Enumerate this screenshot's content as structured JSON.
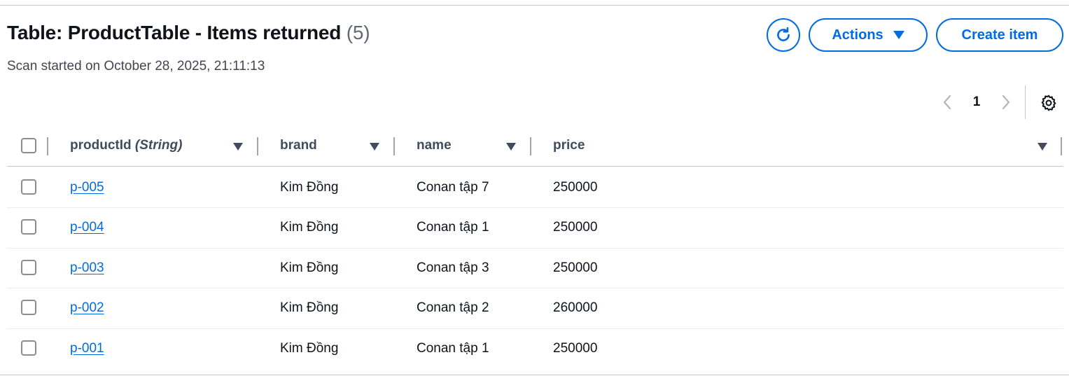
{
  "header": {
    "title": "Table: ProductTable - Items returned",
    "count": "(5)",
    "subtitle": "Scan started on October 28, 2025, 21:11:13",
    "refresh_icon": "refresh-icon",
    "actions_label": "Actions",
    "create_label": "Create item"
  },
  "pagination": {
    "current_page": "1",
    "prev_icon": "chevron-left-icon",
    "next_icon": "chevron-right-icon",
    "settings_icon": "gear-icon"
  },
  "table": {
    "columns": [
      {
        "label": "productId",
        "type": "(String)"
      },
      {
        "label": "brand"
      },
      {
        "label": "name"
      },
      {
        "label": "price"
      }
    ],
    "rows": [
      {
        "productId": "p-005",
        "brand": "Kim Đồng",
        "name": "Conan tập 7",
        "price": "250000"
      },
      {
        "productId": "p-004",
        "brand": "Kim Đồng",
        "name": "Conan tập 1",
        "price": "250000"
      },
      {
        "productId": "p-003",
        "brand": "Kim Đồng",
        "name": "Conan tập 3",
        "price": "250000"
      },
      {
        "productId": "p-002",
        "brand": "Kim Đồng",
        "name": "Conan tập 2",
        "price": "260000"
      },
      {
        "productId": "p-001",
        "brand": "Kim Đồng",
        "name": "Conan tập 1",
        "price": "250000"
      }
    ]
  },
  "colors": {
    "accent": "#006ce0",
    "title": "#0f141a",
    "header_text": "#414d5c",
    "border": "#c6c6cd"
  }
}
